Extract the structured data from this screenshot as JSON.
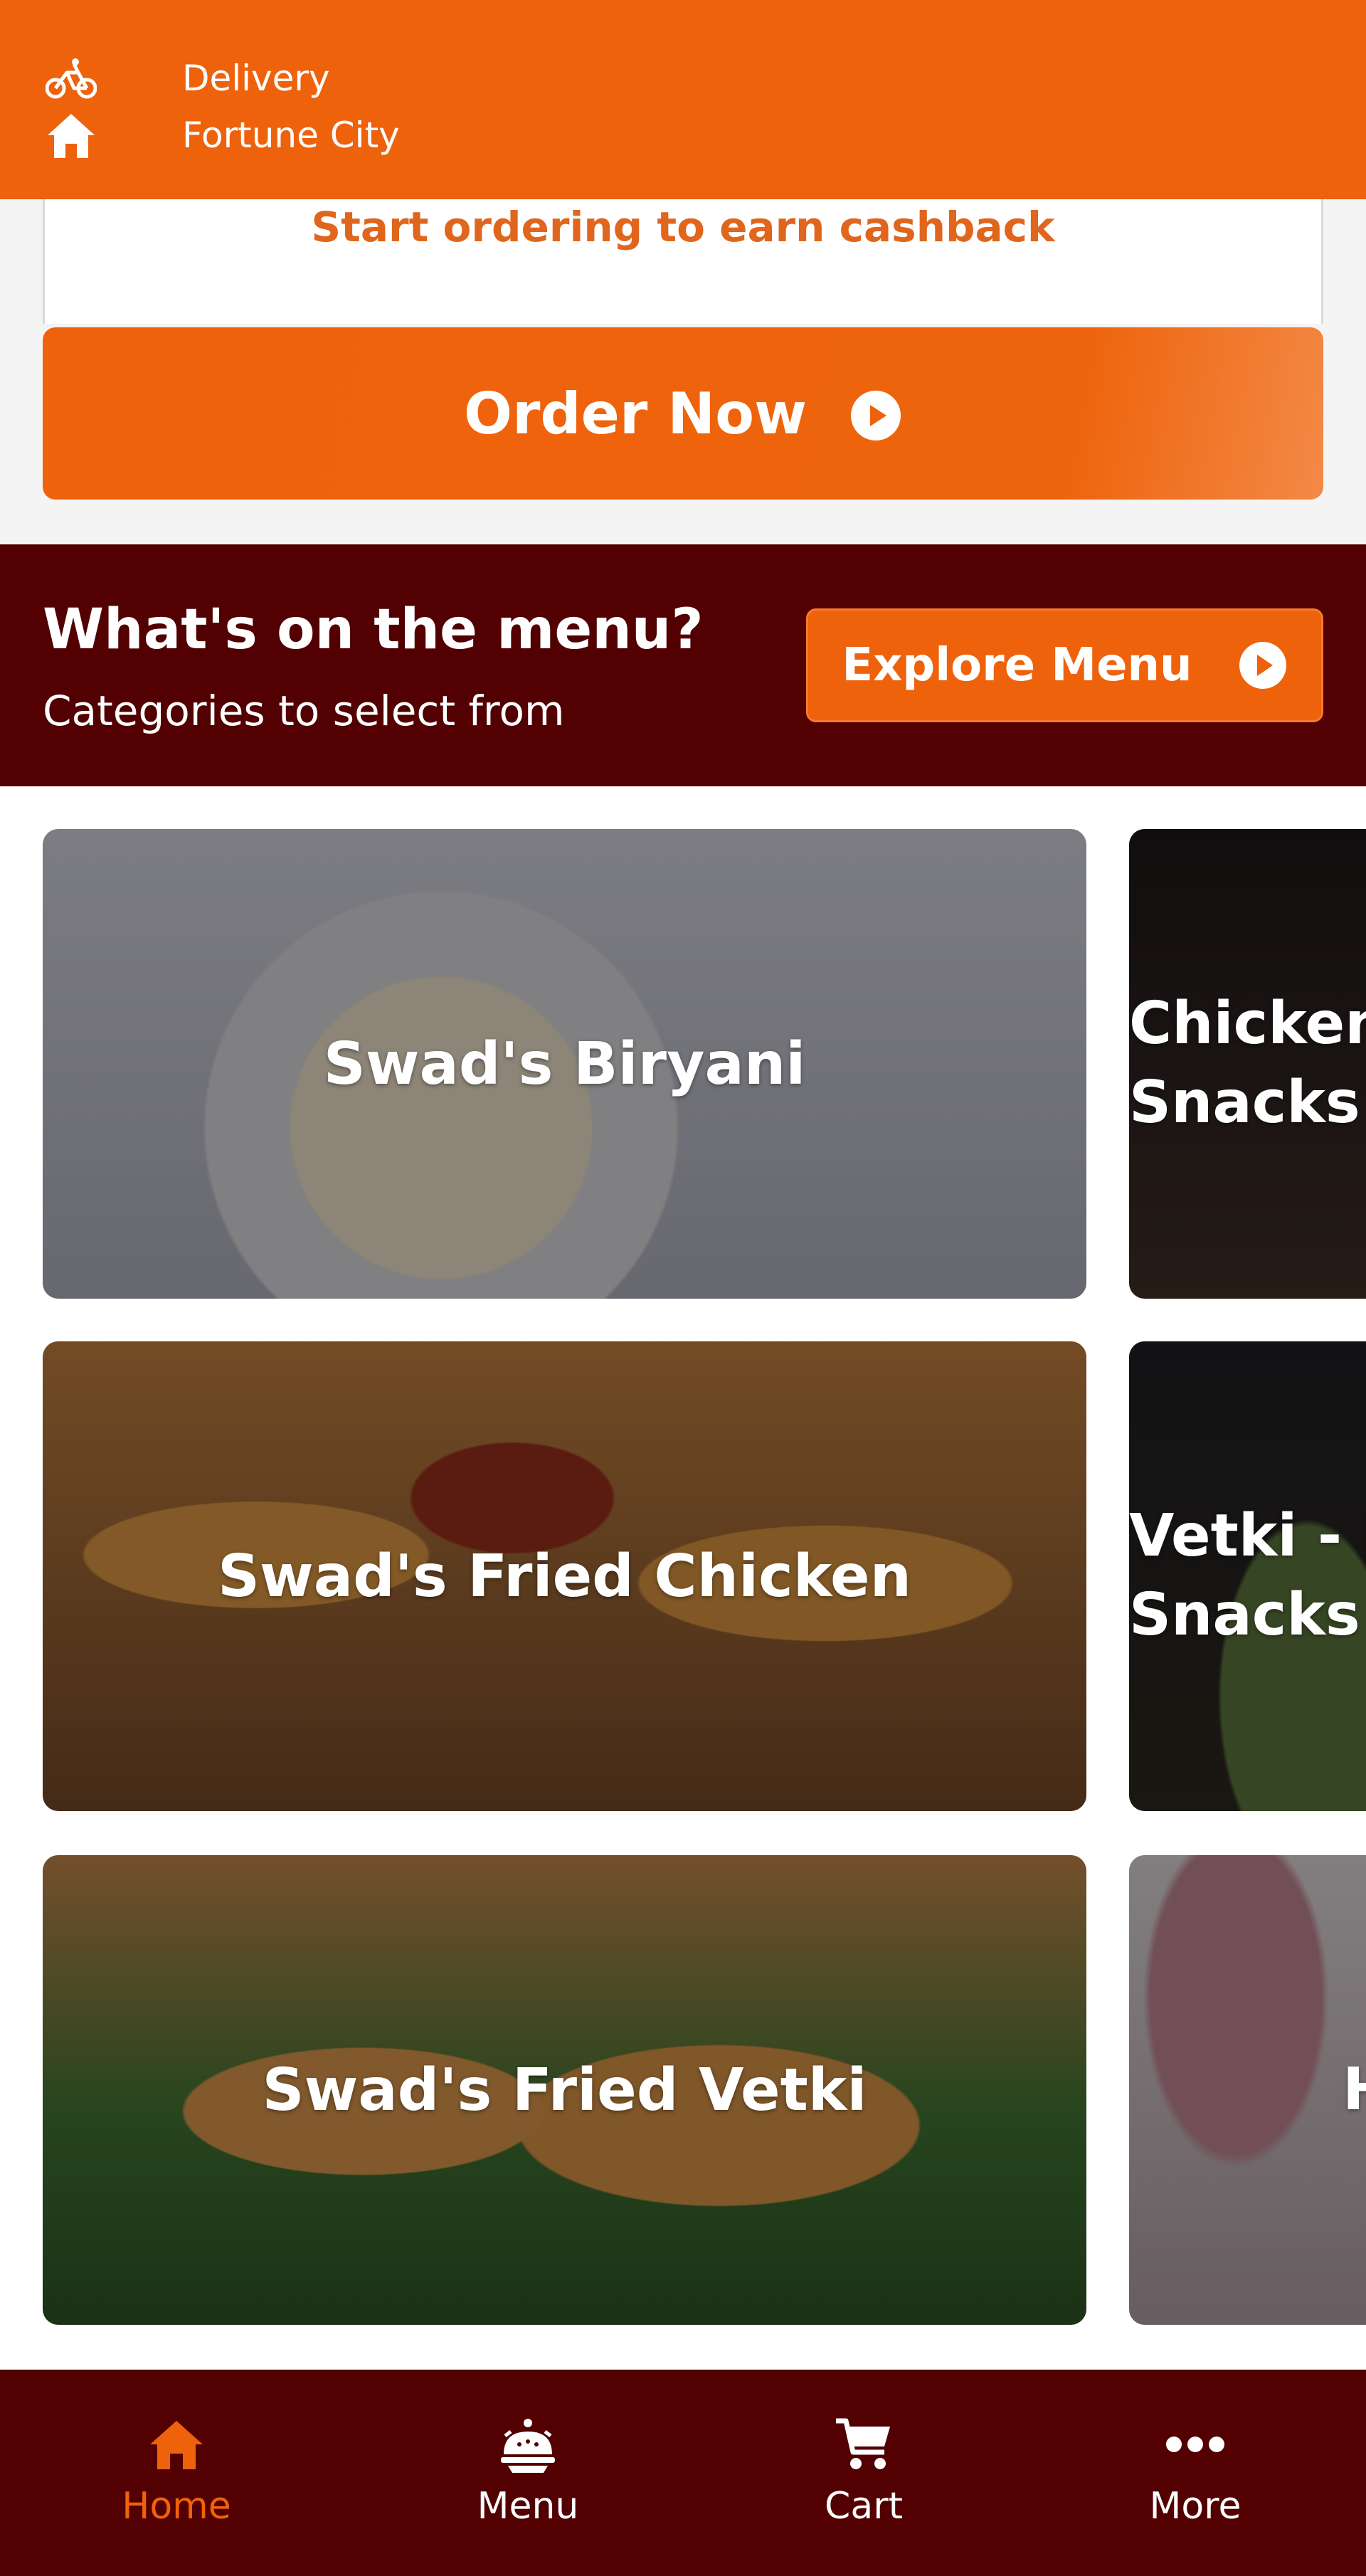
{
  "header": {
    "mode_icon": "bicycle-icon",
    "mode_label": "Delivery",
    "location_icon": "home-icon",
    "location_label": "Fortune City"
  },
  "cashback": {
    "text": "Start ordering to earn cashback"
  },
  "order_button": {
    "label": "Order Now",
    "icon": "play-circle-icon"
  },
  "menu_section": {
    "title": "What's on the menu?",
    "subtitle": "Categories to select from",
    "explore_label": "Explore Menu",
    "explore_icon": "play-circle-icon"
  },
  "categories": [
    {
      "name": "Swad's Biryani"
    },
    {
      "name": "Chicken Snacks",
      "line1": "Chicken",
      "line2": "Snacks"
    },
    {
      "name": "Swad's Fried Chicken"
    },
    {
      "name": "Vetki - B Snacks",
      "line1": "Vetki - B",
      "line2": "Snacks"
    },
    {
      "name": "Swad's Fried Vetki"
    },
    {
      "name": "H"
    }
  ],
  "bottom_nav": [
    {
      "label": "Home",
      "icon": "home-icon",
      "active": true
    },
    {
      "label": "Menu",
      "icon": "cloche-icon",
      "active": false
    },
    {
      "label": "Cart",
      "icon": "cart-icon",
      "active": false
    },
    {
      "label": "More",
      "icon": "more-dots-icon",
      "active": false
    }
  ],
  "colors": {
    "accent": "#ee620b",
    "maroon": "#520002",
    "cashback_text": "#e0661d"
  }
}
